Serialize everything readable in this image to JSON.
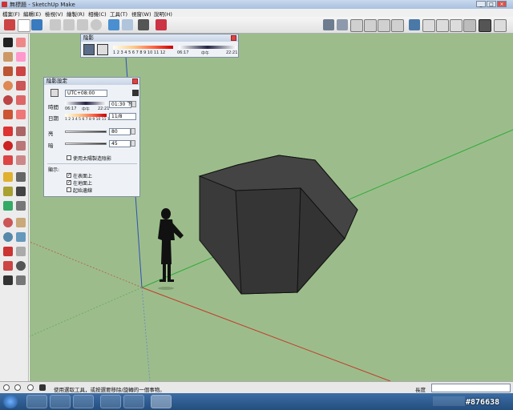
{
  "window": {
    "title": "無標題 - SketchUp Make",
    "buttons": [
      "_",
      "□",
      "×"
    ]
  },
  "menubar": [
    "檔案(F)",
    "編輯(E)",
    "檢視(V)",
    "繪製(R)",
    "相機(C)",
    "工具(T)",
    "視窗(W)",
    "說明(H)"
  ],
  "shadow_toolbar": {
    "title": "陰影",
    "month_ticks": "1 2 3 4 5 6 7 8 9 10 11 12",
    "time_start": "06:17",
    "time_mid": "中午",
    "time_end": "22:21"
  },
  "shadow_settings": {
    "title": "陰影設定",
    "timezone": "UTC+08:00",
    "time_label": "時間",
    "time_start": "06:17",
    "time_mid": "中午",
    "time_end": "22:21",
    "time_value": "01:30 下午",
    "date_label": "日期",
    "month_ticks": "1 2 3 4 5 6 7 8 9 10 11 12",
    "date_value": "11/8",
    "light_label": "亮",
    "light_value": "80",
    "dark_label": "暗",
    "dark_value": "45",
    "sun_shading": "使用太陽製造陰影",
    "display_label": "顯示:",
    "on_faces": "在表面上",
    "on_ground": "在地面上",
    "from_edges": "起始邊線",
    "checks": {
      "sun_shading": false,
      "on_faces": true,
      "on_ground": true,
      "from_edges": false
    }
  },
  "status": {
    "message": "使用選取工具，或按選要移除/旋轉的一個事物。",
    "measure_label": "長度",
    "measure_value": ""
  },
  "watermark": "#876638",
  "colors": {
    "ground": "#9cbd8b",
    "solid": "#3a3a3a",
    "taskbar": "#2f5f96"
  }
}
